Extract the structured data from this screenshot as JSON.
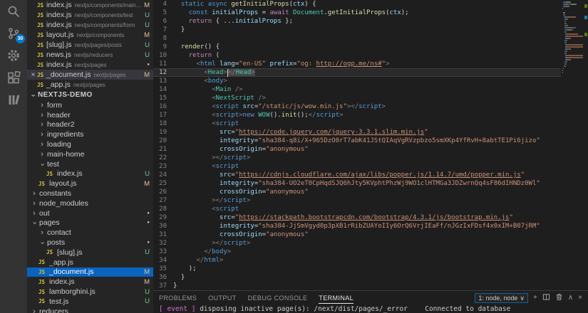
{
  "activity_bar": {
    "icons": [
      "search",
      "source-control",
      "settings-gear",
      "extensions",
      "library"
    ],
    "badge": "30"
  },
  "sidebar": {
    "section_title": "NEXTJS-DEMO",
    "open_editors": [
      {
        "name": "index.js",
        "path": "nextjs/components/main-home",
        "status": "M",
        "status_type": "m"
      },
      {
        "name": "index.js",
        "path": "nextjs/components/test",
        "status": "U",
        "status_type": "u"
      },
      {
        "name": "index.js",
        "path": "nextjs/components/form",
        "status": "U",
        "status_type": "u"
      },
      {
        "name": "layout.js",
        "path": "nextjs/components",
        "status": "M",
        "status_type": "m"
      },
      {
        "name": "[slug].js",
        "path": "nextjs/pages/posts",
        "status": "U",
        "status_type": "u"
      },
      {
        "name": "news.js",
        "path": "nextjs/reducers",
        "status": "U",
        "status_type": "u"
      },
      {
        "name": "index.js",
        "path": "nextjs/pages",
        "status": "●",
        "status_type": "dot"
      },
      {
        "name": "_document.js",
        "path": "nextjs/pages",
        "status": "M",
        "status_type": "m",
        "active": true
      },
      {
        "name": "_app.js",
        "path": "nextjs/pages",
        "status": "",
        "status_type": ""
      }
    ],
    "tree": [
      {
        "kind": "folder",
        "name": "form",
        "level": 1,
        "expanded": false
      },
      {
        "kind": "folder",
        "name": "header",
        "level": 1,
        "expanded": false
      },
      {
        "kind": "folder",
        "name": "header2",
        "level": 1,
        "expanded": false
      },
      {
        "kind": "folder",
        "name": "ingredients",
        "level": 1,
        "expanded": false
      },
      {
        "kind": "folder",
        "name": "loading",
        "level": 1,
        "expanded": false
      },
      {
        "kind": "folder",
        "name": "main-home",
        "level": 1,
        "expanded": false
      },
      {
        "kind": "folder",
        "name": "test",
        "level": 1,
        "expanded": true
      },
      {
        "kind": "file",
        "name": "index.js",
        "level": 2,
        "status": "U",
        "status_type": "u"
      },
      {
        "kind": "file",
        "name": "layout.js",
        "level": 1,
        "status": "M",
        "status_type": "m"
      },
      {
        "kind": "folder",
        "name": "constants",
        "level": 0,
        "expanded": false
      },
      {
        "kind": "folder",
        "name": "node_modules",
        "level": 0,
        "expanded": false
      },
      {
        "kind": "folder",
        "name": "out",
        "level": 0,
        "expanded": false,
        "status": "●",
        "status_type": "dot"
      },
      {
        "kind": "folder",
        "name": "pages",
        "level": 0,
        "expanded": true,
        "status": "●",
        "status_type": "dot"
      },
      {
        "kind": "folder",
        "name": "contact",
        "level": 1,
        "expanded": false
      },
      {
        "kind": "folder",
        "name": "posts",
        "level": 1,
        "expanded": true,
        "status": "●",
        "status_type": "dot"
      },
      {
        "kind": "file",
        "name": "[slug].js",
        "level": 2,
        "status": "U",
        "status_type": "u"
      },
      {
        "kind": "file",
        "name": "_app.js",
        "level": 1,
        "status": "",
        "status_type": ""
      },
      {
        "kind": "file",
        "name": "_document.js",
        "level": 1,
        "status": "M",
        "status_type": "m",
        "selected": true
      },
      {
        "kind": "file",
        "name": "index.js",
        "level": 1,
        "status": "M",
        "status_type": "m"
      },
      {
        "kind": "file",
        "name": "lamborghini.js",
        "level": 1,
        "status": "U",
        "status_type": "u"
      },
      {
        "kind": "file",
        "name": "test.js",
        "level": 1,
        "status": "U",
        "status_type": "u"
      },
      {
        "kind": "folder",
        "name": "reducers",
        "level": 0,
        "expanded": false
      }
    ]
  },
  "editor": {
    "active_line": 12,
    "lines": [
      {
        "num": 4,
        "tokens": [
          [
            "ws",
            "  "
          ],
          [
            "kw",
            "static"
          ],
          [
            "ws",
            " "
          ],
          [
            "kw",
            "async"
          ],
          [
            "ws",
            " "
          ],
          [
            "fn",
            "getInitialProps"
          ],
          [
            "txt",
            "("
          ],
          [
            "var",
            "ctx"
          ],
          [
            "txt",
            ") {"
          ]
        ]
      },
      {
        "num": 5,
        "tokens": [
          [
            "ws",
            "    "
          ],
          [
            "kw",
            "const"
          ],
          [
            "ws",
            " "
          ],
          [
            "var",
            "initialProps"
          ],
          [
            "txt",
            " = "
          ],
          [
            "ctl",
            "await"
          ],
          [
            "ws",
            " "
          ],
          [
            "cls",
            "Document"
          ],
          [
            "txt",
            "."
          ],
          [
            "fn",
            "getInitialProps"
          ],
          [
            "txt",
            "("
          ],
          [
            "var",
            "ctx"
          ],
          [
            "txt",
            ");"
          ]
        ]
      },
      {
        "num": 6,
        "tokens": [
          [
            "ws",
            "    "
          ],
          [
            "ctl",
            "return"
          ],
          [
            "txt",
            " { ..."
          ],
          [
            "var",
            "initialProps"
          ],
          [
            "txt",
            " };"
          ]
        ]
      },
      {
        "num": 7,
        "tokens": [
          [
            "txt",
            "  }"
          ]
        ]
      },
      {
        "num": 8,
        "tokens": []
      },
      {
        "num": 9,
        "tokens": [
          [
            "ws",
            "  "
          ],
          [
            "fn",
            "render"
          ],
          [
            "txt",
            "() {"
          ]
        ]
      },
      {
        "num": 10,
        "tokens": [
          [
            "ws",
            "    "
          ],
          [
            "ctl",
            "return"
          ],
          [
            "txt",
            " ("
          ]
        ]
      },
      {
        "num": 11,
        "tokens": [
          [
            "ws",
            "      "
          ],
          [
            "pun",
            "<"
          ],
          [
            "tag",
            "html"
          ],
          [
            "ws",
            " "
          ],
          [
            "var",
            "lang"
          ],
          [
            "txt",
            "="
          ],
          [
            "str",
            "\"en-US\""
          ],
          [
            "ws",
            " "
          ],
          [
            "var",
            "prefix"
          ],
          [
            "txt",
            "="
          ],
          [
            "str",
            "\"og: "
          ],
          [
            "lnk",
            "http://ogp.me/ns#"
          ],
          [
            "str",
            "\""
          ],
          [
            "pun",
            ">"
          ]
        ]
      },
      {
        "num": 12,
        "tokens": [
          [
            "ws",
            "        "
          ],
          [
            "pun",
            "<"
          ],
          [
            "cls",
            "Head"
          ],
          [
            "pun",
            ">"
          ],
          [
            "cur",
            ""
          ],
          [
            "pun sel",
            "</"
          ],
          [
            "cls sel",
            "Head"
          ],
          [
            "pun sel",
            ">"
          ]
        ]
      },
      {
        "num": 13,
        "tokens": [
          [
            "ws",
            "        "
          ],
          [
            "pun",
            "<"
          ],
          [
            "tag",
            "body"
          ],
          [
            "pun",
            ">"
          ]
        ]
      },
      {
        "num": 14,
        "tokens": [
          [
            "ws",
            "          "
          ],
          [
            "pun",
            "<"
          ],
          [
            "cls",
            "Main"
          ],
          [
            "txt",
            " "
          ],
          [
            "pun",
            "/>"
          ]
        ]
      },
      {
        "num": 15,
        "tokens": [
          [
            "ws",
            "          "
          ],
          [
            "pun",
            "<"
          ],
          [
            "cls",
            "NextScript"
          ],
          [
            "txt",
            " "
          ],
          [
            "pun",
            "/>"
          ]
        ]
      },
      {
        "num": 16,
        "tokens": [
          [
            "ws",
            "          "
          ],
          [
            "pun",
            "<"
          ],
          [
            "tag",
            "script"
          ],
          [
            "ws",
            " "
          ],
          [
            "var",
            "src"
          ],
          [
            "txt",
            "="
          ],
          [
            "str",
            "\"/static/js/wow.min.js\""
          ],
          [
            "pun",
            "></"
          ],
          [
            "tag",
            "script"
          ],
          [
            "pun",
            ">"
          ]
        ]
      },
      {
        "num": 17,
        "tokens": [
          [
            "ws",
            "          "
          ],
          [
            "pun",
            "<"
          ],
          [
            "tag",
            "script"
          ],
          [
            "pun",
            ">"
          ],
          [
            "kw",
            "new"
          ],
          [
            "ws",
            " "
          ],
          [
            "cls",
            "WOW"
          ],
          [
            "txt",
            "()."
          ],
          [
            "fn",
            "init"
          ],
          [
            "txt",
            "();"
          ],
          [
            "pun",
            "</"
          ],
          [
            "tag",
            "script"
          ],
          [
            "pun",
            ">"
          ]
        ]
      },
      {
        "num": 18,
        "tokens": [
          [
            "ws",
            "          "
          ],
          [
            "pun",
            "<"
          ],
          [
            "tag",
            "script"
          ]
        ]
      },
      {
        "num": 19,
        "tokens": [
          [
            "ws",
            "            "
          ],
          [
            "var",
            "src"
          ],
          [
            "txt",
            "="
          ],
          [
            "str",
            "\""
          ],
          [
            "lnk",
            "https://code.jquery.com/jquery-3.3.1.slim.min.js"
          ],
          [
            "str",
            "\""
          ]
        ]
      },
      {
        "num": 20,
        "tokens": [
          [
            "ws",
            "            "
          ],
          [
            "var",
            "integrity"
          ],
          [
            "txt",
            "="
          ],
          [
            "str",
            "\"sha384-q8i/X+965DzO0rT7abK41JStQIAqVgRVzpbzo5smXKp4YfRvH+8abtTE1Pi6jizo\""
          ]
        ]
      },
      {
        "num": 21,
        "tokens": [
          [
            "ws",
            "            "
          ],
          [
            "var",
            "crossOrigin"
          ],
          [
            "txt",
            "="
          ],
          [
            "str",
            "\"anonymous\""
          ]
        ]
      },
      {
        "num": 22,
        "tokens": [
          [
            "ws",
            "          "
          ],
          [
            "pun",
            "></"
          ],
          [
            "tag",
            "script"
          ],
          [
            "pun",
            ">"
          ]
        ]
      },
      {
        "num": 23,
        "tokens": [
          [
            "ws",
            "          "
          ],
          [
            "pun",
            "<"
          ],
          [
            "tag",
            "script"
          ]
        ]
      },
      {
        "num": 24,
        "tokens": [
          [
            "ws",
            "            "
          ],
          [
            "var",
            "src"
          ],
          [
            "txt",
            "="
          ],
          [
            "str",
            "\""
          ],
          [
            "lnk",
            "https://cdnjs.cloudflare.com/ajax/libs/popper.js/1.14.7/umd/popper.min.js"
          ],
          [
            "str",
            "\""
          ]
        ]
      },
      {
        "num": 25,
        "tokens": [
          [
            "ws",
            "            "
          ],
          [
            "var",
            "integrity"
          ],
          [
            "txt",
            "="
          ],
          [
            "str",
            "\"sha384-UO2eT0CpHqdSJQ6hJty5KVphtPhzWj9WO1clHTMGa3JDZwrnQq4sF86dIHNDz0Wl\""
          ]
        ]
      },
      {
        "num": 26,
        "tokens": [
          [
            "ws",
            "            "
          ],
          [
            "var",
            "crossOrigin"
          ],
          [
            "txt",
            "="
          ],
          [
            "str",
            "\"anonymous\""
          ]
        ]
      },
      {
        "num": 27,
        "tokens": [
          [
            "ws",
            "          "
          ],
          [
            "pun",
            "></"
          ],
          [
            "tag",
            "script"
          ],
          [
            "pun",
            ">"
          ]
        ]
      },
      {
        "num": 28,
        "tokens": [
          [
            "ws",
            "          "
          ],
          [
            "pun",
            "<"
          ],
          [
            "tag",
            "script"
          ]
        ]
      },
      {
        "num": 29,
        "tokens": [
          [
            "ws",
            "            "
          ],
          [
            "var",
            "src"
          ],
          [
            "txt",
            "="
          ],
          [
            "str",
            "\""
          ],
          [
            "lnk",
            "https://stackpath.bootstrapcdn.com/bootstrap/4.3.1/js/bootstrap.min.js"
          ],
          [
            "str",
            "\""
          ]
        ]
      },
      {
        "num": 30,
        "tokens": [
          [
            "ws",
            "            "
          ],
          [
            "var",
            "integrity"
          ],
          [
            "txt",
            "="
          ],
          [
            "str",
            "\"sha384-JjSmVgyd0p3pXB1rRibZUAYoIIy6OrQ6VrjIEaFf/nJGzIxFDsf4x0xIM+B07jRM\""
          ]
        ]
      },
      {
        "num": 31,
        "tokens": [
          [
            "ws",
            "            "
          ],
          [
            "var",
            "crossOrigin"
          ],
          [
            "txt",
            "="
          ],
          [
            "str",
            "\"anonymous\""
          ]
        ]
      },
      {
        "num": 32,
        "tokens": [
          [
            "ws",
            "          "
          ],
          [
            "pun",
            "></"
          ],
          [
            "tag",
            "script"
          ],
          [
            "pun",
            ">"
          ]
        ]
      },
      {
        "num": 33,
        "tokens": [
          [
            "ws",
            "        "
          ],
          [
            "pun",
            "</"
          ],
          [
            "tag",
            "body"
          ],
          [
            "pun",
            ">"
          ]
        ]
      },
      {
        "num": 34,
        "tokens": [
          [
            "ws",
            "      "
          ],
          [
            "pun",
            "</"
          ],
          [
            "tag",
            "html"
          ],
          [
            "pun",
            ">"
          ]
        ]
      },
      {
        "num": 35,
        "tokens": [
          [
            "ws",
            "    "
          ],
          [
            "txt",
            ");"
          ]
        ]
      },
      {
        "num": 36,
        "tokens": [
          [
            "txt",
            "  }"
          ]
        ]
      },
      {
        "num": 37,
        "tokens": [
          [
            "txt",
            "}"
          ]
        ]
      }
    ]
  },
  "panel": {
    "tabs": [
      "PROBLEMS",
      "OUTPUT",
      "DEBUG CONSOLE",
      "TERMINAL"
    ],
    "active_tab": "TERMINAL",
    "terminal_selector": "1: node, node",
    "terminal_left_prefix": "[ event ]",
    "terminal_left_text": " disposing inactive page(s): /next/dist/pages/_error",
    "terminal_right_text": "Connected to database"
  },
  "colors": {
    "accent": "#007acc",
    "git_modified": "#e2c08d",
    "git_untracked": "#73c991",
    "list_selection": "#0a63be",
    "editor_background": "#1e1e1e",
    "sidebar_background": "#252526",
    "activity_bar_background": "#333333"
  }
}
